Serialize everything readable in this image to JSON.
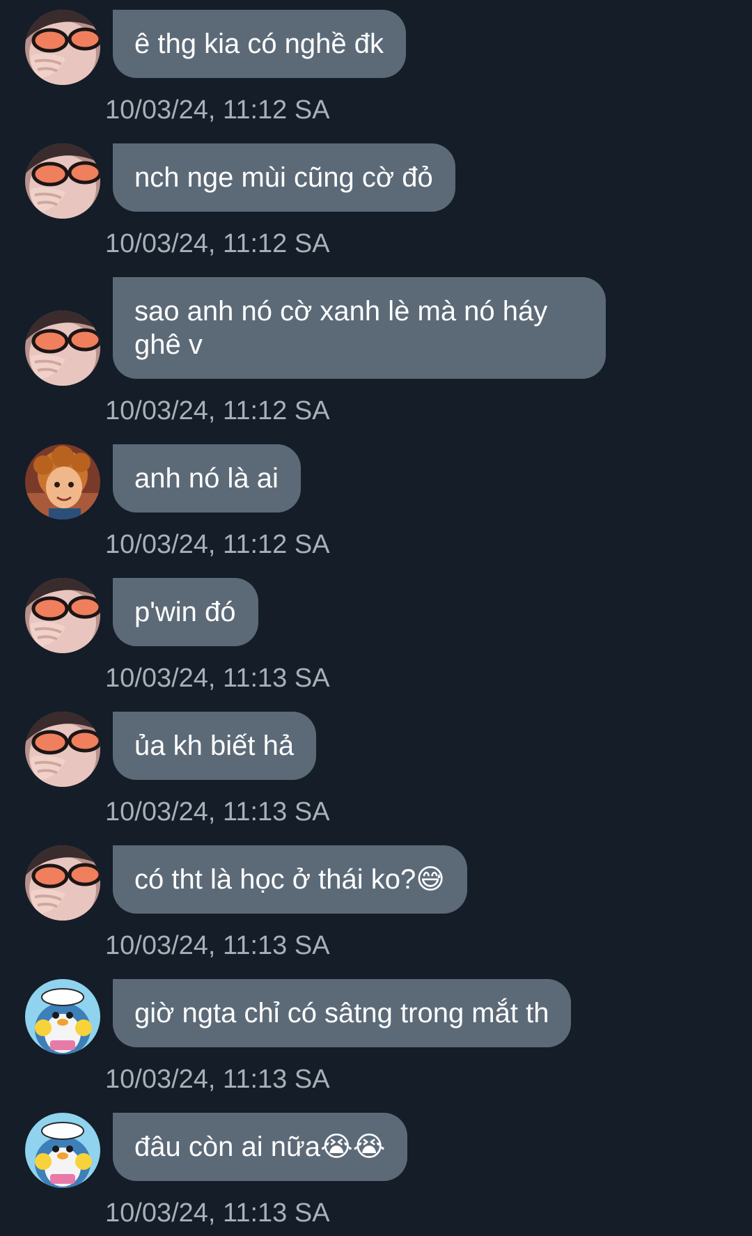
{
  "messages": [
    {
      "text": "ê thg kia có nghề đk",
      "time": "10/03/24, 11:12 SA",
      "avatar": "sunglasses-person-avatar"
    },
    {
      "text": "nch nge mùi cũng cờ đỏ",
      "time": "10/03/24, 11:12 SA",
      "avatar": "sunglasses-person-avatar"
    },
    {
      "text": "sao anh nó cờ xanh lè mà nó háy ghê v",
      "time": "10/03/24, 11:12 SA",
      "avatar": "sunglasses-person-avatar"
    },
    {
      "text": "anh nó là ai",
      "time": "10/03/24, 11:12 SA",
      "avatar": "cartoon-boy-avatar"
    },
    {
      "text": "p'win đó",
      "time": "10/03/24, 11:13 SA",
      "avatar": "sunglasses-person-avatar"
    },
    {
      "text": "ủa kh biết hả",
      "time": "10/03/24, 11:13 SA",
      "avatar": "sunglasses-person-avatar"
    },
    {
      "text": "có tht là học ở thái ko?😅",
      "time": "10/03/24, 11:13 SA",
      "avatar": "sunglasses-person-avatar"
    },
    {
      "text": "giờ ngta chỉ có sâtng trong mắt th",
      "time": "10/03/24, 11:13 SA",
      "avatar": "penguin-cartoon-avatar"
    },
    {
      "text": "đâu còn ai nữa😭😭",
      "time": "10/03/24, 11:13 SA",
      "avatar": "penguin-cartoon-avatar"
    }
  ],
  "colors": {
    "background": "#151d28",
    "bubble": "#5c6a78",
    "bubble_text": "#ffffff",
    "timestamp_text": "#a9b0b8"
  }
}
